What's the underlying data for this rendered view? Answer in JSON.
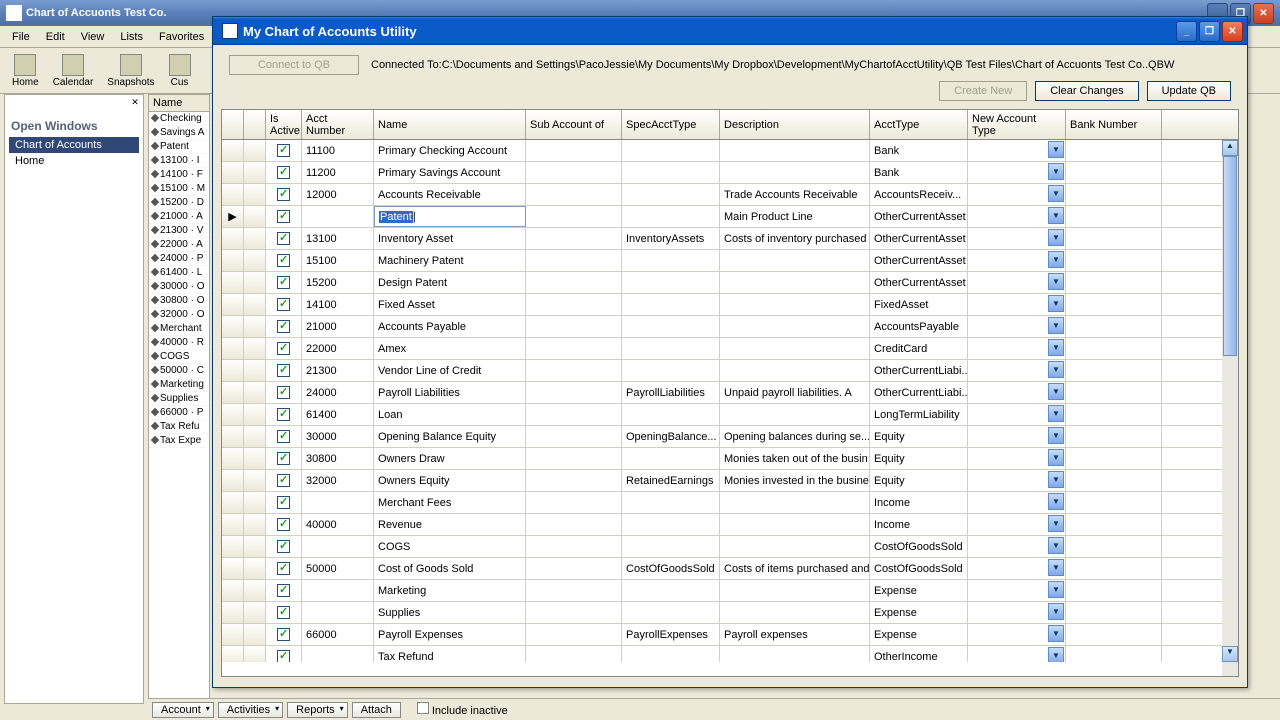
{
  "back": {
    "title": "Chart of Accuonts Test Co.",
    "menus": [
      "File",
      "Edit",
      "View",
      "Lists",
      "Favorites"
    ],
    "toolbar": [
      "Home",
      "Calendar",
      "Snapshots",
      "Cus"
    ],
    "open_windows_title": "Open Windows",
    "open_windows": [
      "Chart of Accounts",
      "Home"
    ],
    "list_header": "Name",
    "list_items": [
      "Checking",
      "Savings A",
      "Patent",
      "13100 · I",
      "14100 · F",
      "15100 · M",
      "15200 · D",
      "21000 · A",
      "21300 · V",
      "22000 · A",
      "24000 · P",
      "61400 · L",
      "30000 · O",
      "30800 · O",
      "32000 · O",
      "Merchant",
      "40000 · R",
      "COGS",
      "50000 · C",
      "Marketing",
      "Supplies",
      "66000 · P",
      "Tax Refu",
      "Tax Expe"
    ]
  },
  "bottom": {
    "account": "Account",
    "activities": "Activities",
    "reports": "Reports",
    "attach": "Attach",
    "include_inactive": "Include inactive"
  },
  "util": {
    "title": "My Chart of Accounts Utility",
    "connect_btn": "Connect to QB",
    "connected": "Connected To:C:\\Documents and Settings\\PacoJessie\\My Documents\\My Dropbox\\Development\\MyChartofAcctUtility\\QB Test Files\\Chart of Accuonts Test Co..QBW",
    "create_new": "Create New",
    "clear_changes": "Clear Changes",
    "update_qb": "Update QB",
    "cols": {
      "is_active": "Is Active",
      "acct_number": "Acct Number",
      "name": "Name",
      "sub": "Sub Account of",
      "spec": "SpecAcctType",
      "desc": "Description",
      "type": "AcctType",
      "new_type": "New Account Type",
      "bank": "Bank Number"
    }
  },
  "rows": [
    {
      "num": "11100",
      "name": "Primary Checking Account",
      "sub": "",
      "spec": "",
      "desc": "",
      "type": "Bank"
    },
    {
      "num": "11200",
      "name": "Primary Savings Account",
      "sub": "",
      "spec": "",
      "desc": "",
      "type": "Bank"
    },
    {
      "num": "12000",
      "name": "Accounts Receivable",
      "sub": "",
      "spec": "",
      "desc": "Trade Accounts Receivable",
      "type": "AccountsReceiv..."
    },
    {
      "num": "",
      "name": "Patent",
      "sub": "",
      "spec": "",
      "desc": "Main Product Line",
      "type": "OtherCurrentAsset",
      "editing": true
    },
    {
      "num": "13100",
      "name": "Inventory Asset",
      "sub": "",
      "spec": "InventoryAssets",
      "desc": "Costs of inventory purchased",
      "type": "OtherCurrentAsset"
    },
    {
      "num": "15100",
      "name": "Machinery Patent",
      "sub": "",
      "spec": "",
      "desc": "",
      "type": "OtherCurrentAsset"
    },
    {
      "num": "15200",
      "name": "Design Patent",
      "sub": "",
      "spec": "",
      "desc": "",
      "type": "OtherCurrentAsset"
    },
    {
      "num": "14100",
      "name": "Fixed Asset",
      "sub": "",
      "spec": "",
      "desc": "",
      "type": "FixedAsset"
    },
    {
      "num": "21000",
      "name": "Accounts Payable",
      "sub": "",
      "spec": "",
      "desc": "",
      "type": "AccountsPayable"
    },
    {
      "num": "22000",
      "name": "Amex",
      "sub": "",
      "spec": "",
      "desc": "",
      "type": "CreditCard"
    },
    {
      "num": "21300",
      "name": "Vendor Line of Credit",
      "sub": "",
      "spec": "",
      "desc": "",
      "type": "OtherCurrentLiabi..."
    },
    {
      "num": "24000",
      "name": "Payroll Liabilities",
      "sub": "",
      "spec": "PayrollLiabilities",
      "desc": "Unpaid payroll liabilities. A",
      "type": "OtherCurrentLiabi..."
    },
    {
      "num": "61400",
      "name": "Loan",
      "sub": "",
      "spec": "",
      "desc": "",
      "type": "LongTermLiability"
    },
    {
      "num": "30000",
      "name": "Opening Balance Equity",
      "sub": "",
      "spec": "OpeningBalance...",
      "desc": "Opening balances during se...",
      "type": "Equity"
    },
    {
      "num": "30800",
      "name": "Owners Draw",
      "sub": "",
      "spec": "",
      "desc": "Monies taken out of the busin",
      "type": "Equity"
    },
    {
      "num": "32000",
      "name": "Owners Equity",
      "sub": "",
      "spec": "RetainedEarnings",
      "desc": "Monies invested in the busine",
      "type": "Equity"
    },
    {
      "num": "",
      "name": "Merchant Fees",
      "sub": "",
      "spec": "",
      "desc": "",
      "type": "Income"
    },
    {
      "num": "40000",
      "name": "Revenue",
      "sub": "",
      "spec": "",
      "desc": "",
      "type": "Income"
    },
    {
      "num": "",
      "name": "COGS",
      "sub": "",
      "spec": "",
      "desc": "",
      "type": "CostOfGoodsSold"
    },
    {
      "num": "50000",
      "name": "Cost of Goods Sold",
      "sub": "",
      "spec": "CostOfGoodsSold",
      "desc": "Costs of items purchased and",
      "type": "CostOfGoodsSold"
    },
    {
      "num": "",
      "name": "Marketing",
      "sub": "",
      "spec": "",
      "desc": "",
      "type": "Expense"
    },
    {
      "num": "",
      "name": "Supplies",
      "sub": "",
      "spec": "",
      "desc": "",
      "type": "Expense"
    },
    {
      "num": "66000",
      "name": "Payroll Expenses",
      "sub": "",
      "spec": "PayrollExpenses",
      "desc": "Payroll expenses",
      "type": "Expense"
    },
    {
      "num": "",
      "name": "Tax Refund",
      "sub": "",
      "spec": "",
      "desc": "",
      "type": "OtherIncome"
    }
  ]
}
